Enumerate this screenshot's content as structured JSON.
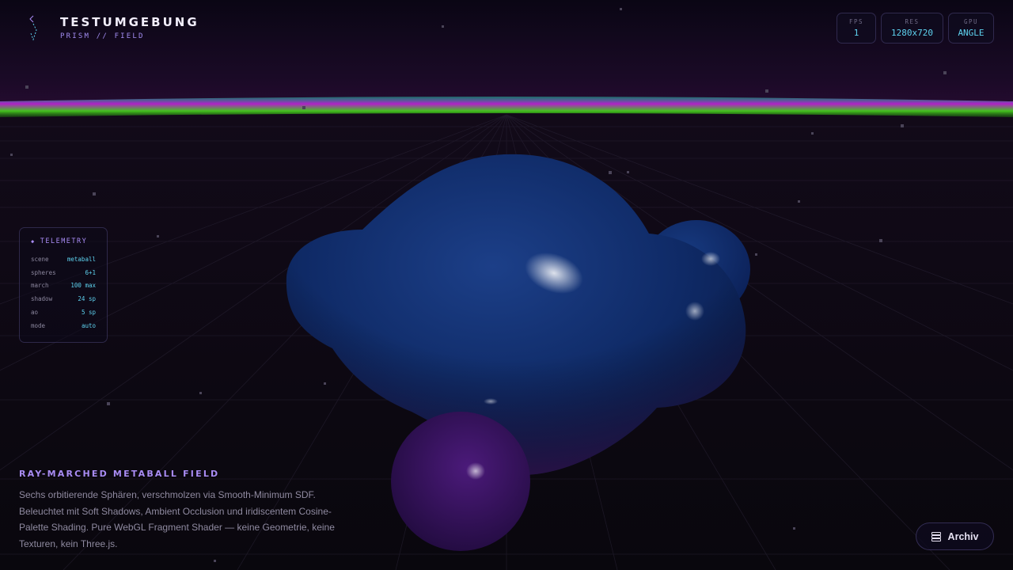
{
  "header": {
    "title": "TESTUMGEBUNG",
    "subtitle": "PRISM // FIELD",
    "logo_icon": "prism-logo-icon"
  },
  "stats": [
    {
      "label": "FPS",
      "value": "1"
    },
    {
      "label": "RES",
      "value": "1280x720"
    },
    {
      "label": "GPU",
      "value": "ANGLE"
    }
  ],
  "telemetry": {
    "title": "TELEMETRY",
    "rows": [
      {
        "key": "scene",
        "value": "metaball"
      },
      {
        "key": "spheres",
        "value": "6+1"
      },
      {
        "key": "march",
        "value": "100 max"
      },
      {
        "key": "shadow",
        "value": "24 sp"
      },
      {
        "key": "ao",
        "value": "5 sp"
      },
      {
        "key": "mode",
        "value": "auto"
      }
    ]
  },
  "description": {
    "title": "Ray-marched Metaball Field",
    "text": "Sechs orbitierende Sphären, verschmolzen via Smooth-Minimum SDF. Beleuchtet mit Soft Shadows, Ambient Occlusion und iridiscentem Cosine-Palette Shading. Pure WebGL Fragment Shader — keine Geometrie, keine Texturen, kein Three.js."
  },
  "archive_button": {
    "label": "Archiv",
    "icon": "database-icon"
  },
  "colors": {
    "accent_purple": "#a98cf5",
    "accent_cyan": "#5ed2ef",
    "background": "#0c0712"
  }
}
